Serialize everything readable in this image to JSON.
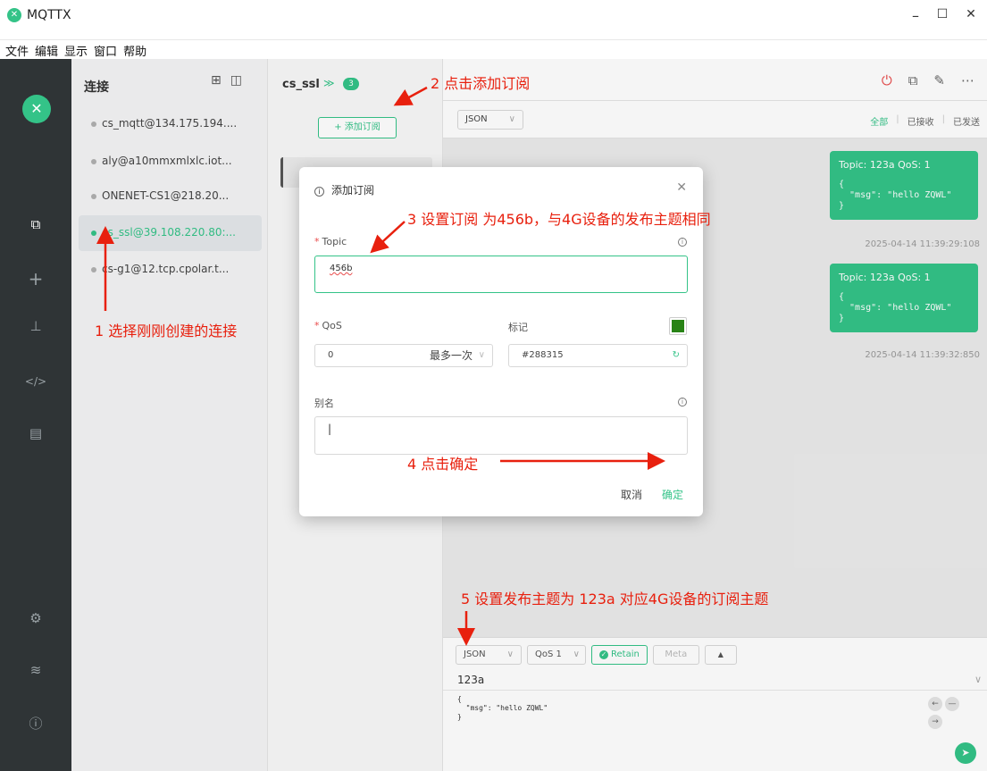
{
  "window": {
    "app_title": "MQTTX",
    "minimize_glyph": "–",
    "maximize_glyph": "☐",
    "close_glyph": "✕"
  },
  "menu": [
    "文件",
    "编辑",
    "显示",
    "窗口",
    "帮助"
  ],
  "connections_panel": {
    "title": "连接",
    "items": [
      {
        "label": "cs_mqtt@134.175.194...."
      },
      {
        "label": "aly@a10mmxmlxlc.iot..."
      },
      {
        "label": "ONENET-CS1@218.20..."
      },
      {
        "label": "cs_ssl@39.108.220.80:...",
        "active": true
      },
      {
        "label": "cs-g1@12.tcp.cpolar.t..."
      }
    ]
  },
  "subscriptions_panel": {
    "connection_name": "cs_ssl",
    "badge_count": "3",
    "add_subscription_label": "+ 添加订阅"
  },
  "messages": {
    "format": "JSON",
    "filters": {
      "all": "全部",
      "received": "已接收",
      "sent": "已发送"
    },
    "items": [
      {
        "header": "Topic: 123a   QoS: 1",
        "payload": "{\n  \"msg\": \"hello ZQWL\"\n}",
        "time": "2025-04-14 11:39:29:108"
      },
      {
        "header": "Topic: 123a   QoS: 1",
        "payload": "{\n  \"msg\": \"hello ZQWL\"\n}",
        "time": "2025-04-14 11:39:32:850"
      }
    ]
  },
  "publish": {
    "format": "JSON",
    "qos": "QoS 1",
    "retain": "Retain",
    "meta": "Meta",
    "topic": "123a",
    "payload": "{\n  \"msg\": \"hello ZQWL\"\n}"
  },
  "dialog": {
    "title": "添加订阅",
    "topic_label": "Topic",
    "topic_value": "456b",
    "qos_label": "QoS",
    "qos_value": "0",
    "qos_desc": "最多一次",
    "color_label": "标记",
    "color_value": "#288315",
    "alias_label": "别名",
    "cancel": "取消",
    "confirm": "确定"
  },
  "annotations": {
    "step1": "1 选择刚刚创建的连接",
    "step2": "2 点击添加订阅",
    "step3": "3 设置订阅 为456b，与4G设备的发布主题相同",
    "step4": "4 点击确定",
    "step5": "5 设置发布主题为 123a 对应4G设备的订阅主题"
  },
  "colors": {
    "accent": "#34c388",
    "annotation": "#e8200e",
    "nav_bg": "#2f3436",
    "tag_color": "#288315"
  }
}
